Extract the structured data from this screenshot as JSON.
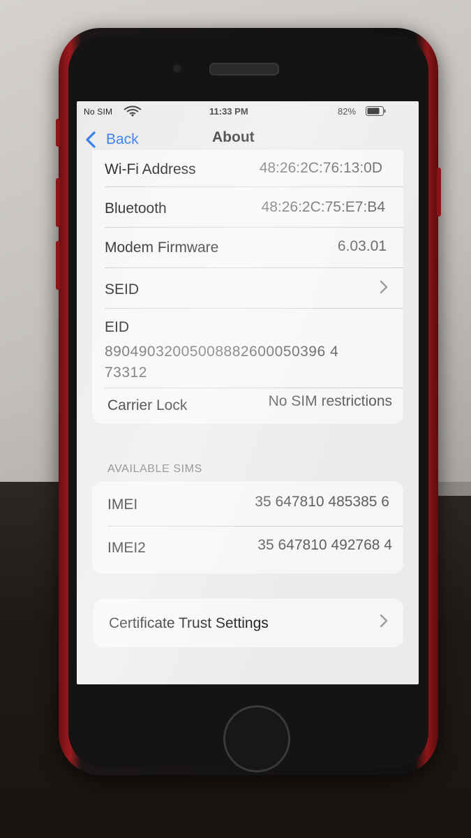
{
  "status_bar": {
    "carrier": "No SIM",
    "time": "11:33 PM",
    "battery": "82%"
  },
  "nav": {
    "back_label": "Back",
    "title": "About"
  },
  "rows": {
    "wifi_address": {
      "label": "Wi-Fi Address",
      "value": "48:26:2C:76:13:0D"
    },
    "bluetooth": {
      "label": "Bluetooth",
      "value": "48:26:2C:75:E7:B4"
    },
    "modem_firmware": {
      "label": "Modem Firmware",
      "value": "6.03.01"
    },
    "seid": {
      "label": "SEID"
    },
    "eid": {
      "label": "EID",
      "value_line1": "89049032005008882600050396 4",
      "value_line2": "73312"
    },
    "carrier_lock": {
      "label": "Carrier Lock",
      "value": "No SIM restrictions"
    }
  },
  "available_sims": {
    "header": "AVAILABLE SIMS",
    "imei": {
      "label": "IMEI",
      "value": "35 647810 485385 6"
    },
    "imei2": {
      "label": "IMEI2",
      "value": "35 647810 492768 4"
    }
  },
  "certificate_trust": {
    "label": "Certificate Trust Settings"
  },
  "colors": {
    "accent": "#2d79f0",
    "phone_body": "#9c1a1e",
    "screen_bg": "#ecebea",
    "group_bg": "#f7f6f5"
  }
}
